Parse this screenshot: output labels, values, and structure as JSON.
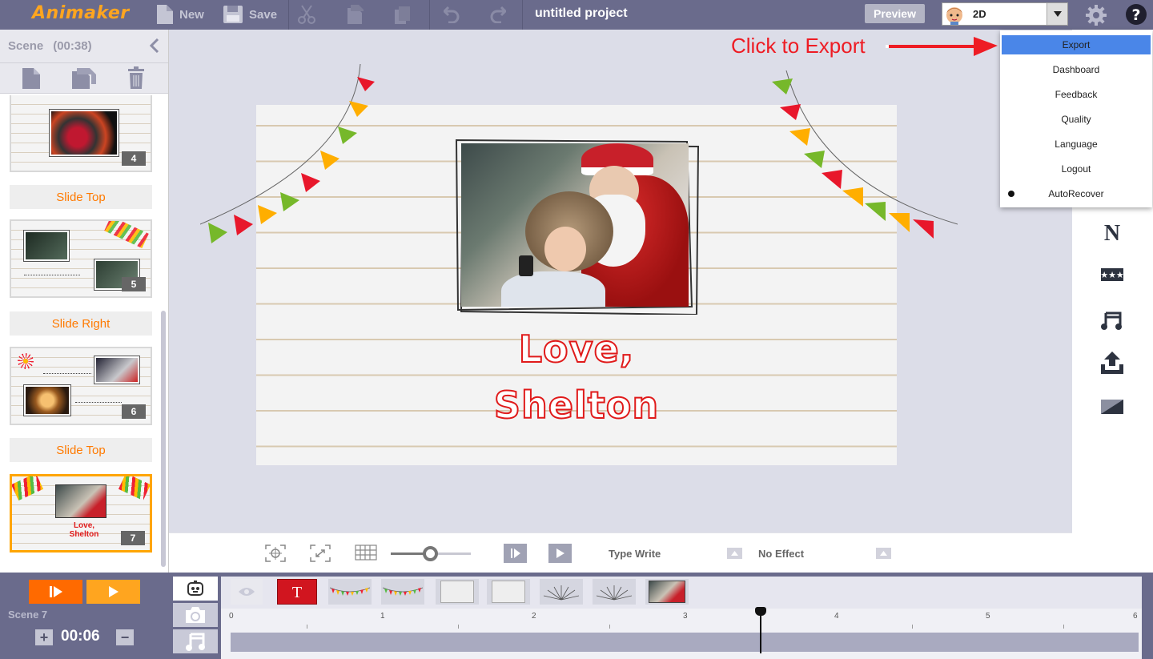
{
  "app": {
    "logo_text": "Animaker",
    "project_title": "untitled project",
    "mode": "2D"
  },
  "toolbar": {
    "new_label": "New",
    "save_label": "Save",
    "preview_label": "Preview"
  },
  "scene_panel": {
    "header": "Scene",
    "duration": "(00:38)",
    "scenes": [
      {
        "number": "4"
      },
      {
        "number": "5"
      },
      {
        "number": "6"
      },
      {
        "number": "7"
      }
    ],
    "transitions": [
      "Slide Top",
      "Slide Right",
      "Slide Top"
    ]
  },
  "canvas": {
    "text_line1": "Love,",
    "text_line2": "Shelton"
  },
  "menu": {
    "items": [
      "Export",
      "Dashboard",
      "Feedback",
      "Quality",
      "Language",
      "Logout",
      "AutoRecover"
    ],
    "active": "Export"
  },
  "annotation": {
    "text": "Click to Export"
  },
  "controls": {
    "enter_effect": "Type Write",
    "exit_effect": "No Effect",
    "zoom_fraction": 0.5
  },
  "timeline": {
    "scene_label": "Scene  7",
    "time": "00:06",
    "ruler_ticks": [
      "0",
      "1",
      "2",
      "3",
      "4",
      "5",
      "6"
    ],
    "playhead_seconds": 3.5
  },
  "colors": {
    "accent_orange": "#ffa51f",
    "deep_orange": "#ff6a00",
    "toolbar_bg": "#6a6b8c",
    "menu_highlight": "#4a86e8",
    "text_red": "#e01a1a"
  }
}
